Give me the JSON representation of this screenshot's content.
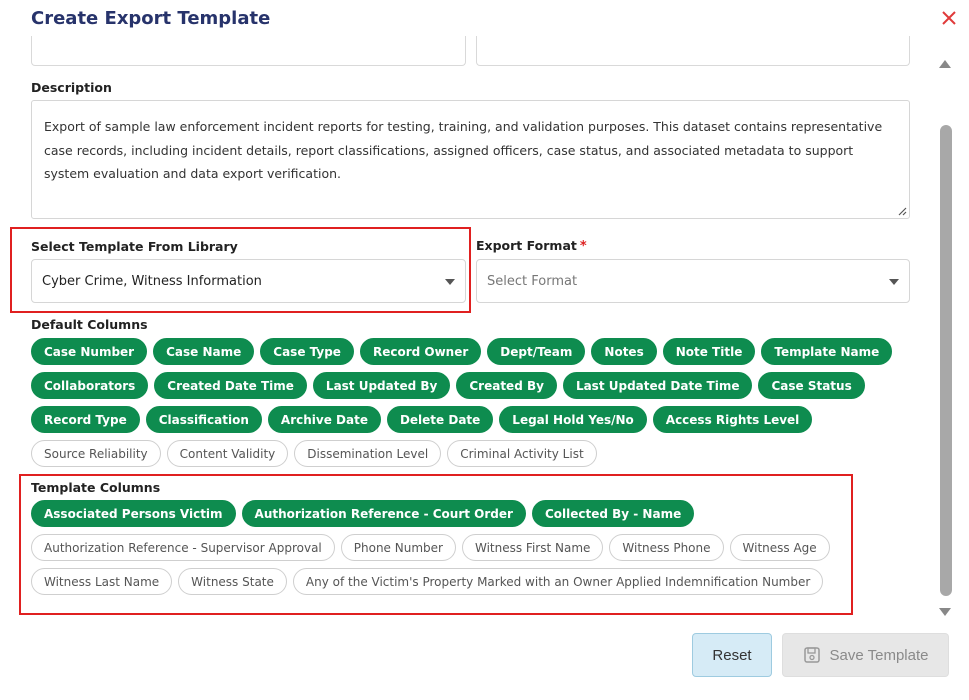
{
  "dialog": {
    "title": "Create Export Template"
  },
  "description": {
    "label": "Description",
    "value": "Export of sample law enforcement incident reports for testing, training, and validation purposes. This dataset contains representative case records, including incident details, report classifications, assigned officers, case status, and associated metadata to support system evaluation and data export verification."
  },
  "template_library": {
    "label": "Select Template From Library",
    "value": "Cyber Crime, Witness Information"
  },
  "export_format": {
    "label": "Export Format",
    "required_mark": "*",
    "placeholder": "Select Format"
  },
  "default_columns": {
    "label": "Default Columns",
    "items": [
      {
        "label": "Case Number",
        "selected": true
      },
      {
        "label": "Case Name",
        "selected": true
      },
      {
        "label": "Case Type",
        "selected": true
      },
      {
        "label": "Record Owner",
        "selected": true
      },
      {
        "label": "Dept/Team",
        "selected": true
      },
      {
        "label": "Notes",
        "selected": true
      },
      {
        "label": "Note Title",
        "selected": true
      },
      {
        "label": "Template Name",
        "selected": true
      },
      {
        "label": "Collaborators",
        "selected": true
      },
      {
        "label": "Created Date Time",
        "selected": true
      },
      {
        "label": "Last Updated By",
        "selected": true
      },
      {
        "label": "Created By",
        "selected": true
      },
      {
        "label": "Last Updated Date Time",
        "selected": true
      },
      {
        "label": "Case Status",
        "selected": true
      },
      {
        "label": "Record Type",
        "selected": true
      },
      {
        "label": "Classification",
        "selected": true
      },
      {
        "label": "Archive Date",
        "selected": true
      },
      {
        "label": "Delete Date",
        "selected": true
      },
      {
        "label": "Legal Hold Yes/No",
        "selected": true
      },
      {
        "label": "Access Rights Level",
        "selected": true
      },
      {
        "label": "Source Reliability",
        "selected": false
      },
      {
        "label": "Content Validity",
        "selected": false
      },
      {
        "label": "Dissemination Level",
        "selected": false
      },
      {
        "label": "Criminal Activity List",
        "selected": false
      }
    ]
  },
  "template_columns": {
    "label": "Template Columns",
    "items": [
      {
        "label": "Associated Persons Victim",
        "selected": true
      },
      {
        "label": "Authorization Reference - Court Order",
        "selected": true
      },
      {
        "label": "Collected By - Name",
        "selected": true
      },
      {
        "label": "Authorization Reference - Supervisor Approval",
        "selected": false
      },
      {
        "label": "Phone Number",
        "selected": false
      },
      {
        "label": "Witness First Name",
        "selected": false
      },
      {
        "label": "Witness Phone",
        "selected": false
      },
      {
        "label": "Witness Age",
        "selected": false
      },
      {
        "label": "Witness Last Name",
        "selected": false
      },
      {
        "label": "Witness State",
        "selected": false
      },
      {
        "label": "Any of the Victim's Property Marked with an Owner Applied Indemnification Number",
        "selected": false
      }
    ]
  },
  "actions": {
    "reset_label": "Reset",
    "save_label": "Save Template"
  },
  "colors": {
    "selected_chip": "#0e8c4f",
    "highlight_box": "#e02020",
    "title": "#27336b"
  }
}
